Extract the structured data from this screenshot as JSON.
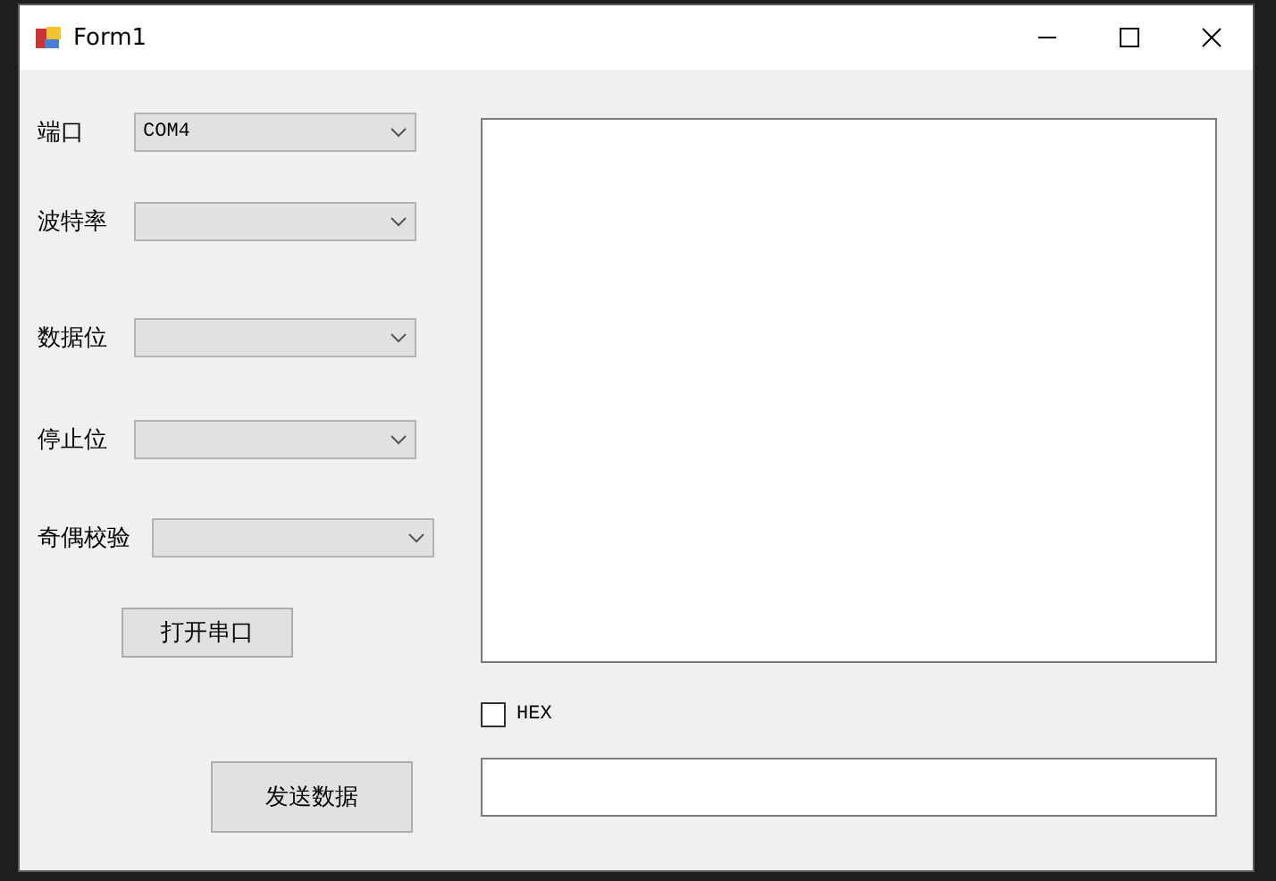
{
  "window": {
    "title": "Form1"
  },
  "settings": [
    {
      "label": "端口",
      "value": "COM4"
    },
    {
      "label": "波特率"
    },
    {
      "label": "数据位"
    },
    {
      "label": "停止位"
    },
    {
      "label": "奇偶校验"
    }
  ],
  "open_button": "打开串口",
  "hex_checkbox": {
    "label": "HEX",
    "checked": false
  },
  "send_button": "发送数据"
}
